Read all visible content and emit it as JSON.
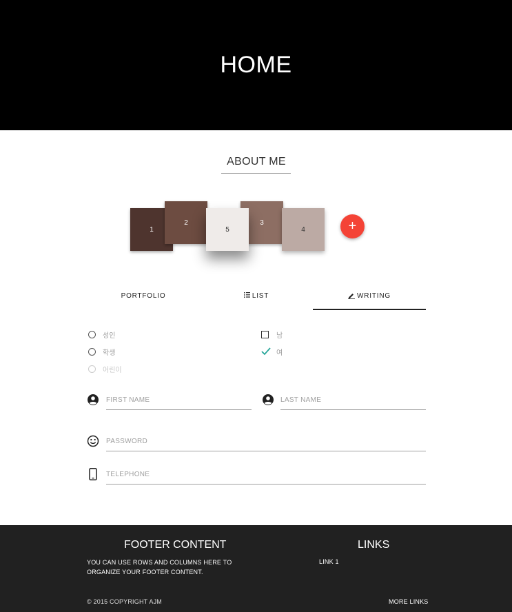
{
  "header": {
    "title": "HOME"
  },
  "about": {
    "title": "ABOUT ME"
  },
  "cards": [
    {
      "label": "1",
      "color": "#4e342e"
    },
    {
      "label": "2",
      "color": "#6d4c41"
    },
    {
      "label": "3",
      "color": "#8d6e63"
    },
    {
      "label": "4",
      "color": "#bcaaa4"
    },
    {
      "label": "5",
      "color": "#efebe9"
    }
  ],
  "fab": {
    "label": "+",
    "color": "#f44336",
    "icon": "plus-icon"
  },
  "tabs": [
    {
      "label": "PORTFOLIO",
      "icon": ""
    },
    {
      "label": "LIST",
      "icon": "list-icon"
    },
    {
      "label": "WRITING",
      "icon": "pencil-icon",
      "active": true
    }
  ],
  "radios": [
    {
      "label": "성인",
      "disabled": false
    },
    {
      "label": "학생",
      "disabled": false
    },
    {
      "label": "어린이",
      "disabled": true
    }
  ],
  "checks": [
    {
      "label": "남",
      "checked": false
    },
    {
      "label": "여",
      "checked": true
    }
  ],
  "form": {
    "first_name_placeholder": "FIRST NAME",
    "last_name_placeholder": "LAST NAME",
    "password_placeholder": "PASSWORD",
    "telephone_placeholder": "TELEPHONE"
  },
  "footer": {
    "content_title": "FOOTER CONTENT",
    "content_text": "YOU CAN USE ROWS AND COLUMNS HERE TO ORGANIZE YOUR FOOTER CONTENT.",
    "links_title": "LINKS",
    "link1": "LINK 1",
    "copyright": "© 2015 COPYRIGHT AJM",
    "more_links": "MORE LINKS"
  },
  "colors": {
    "header_bg": "#000000",
    "footer_bg": "#212121",
    "accent": "#f44336",
    "check": "#26a69a"
  }
}
